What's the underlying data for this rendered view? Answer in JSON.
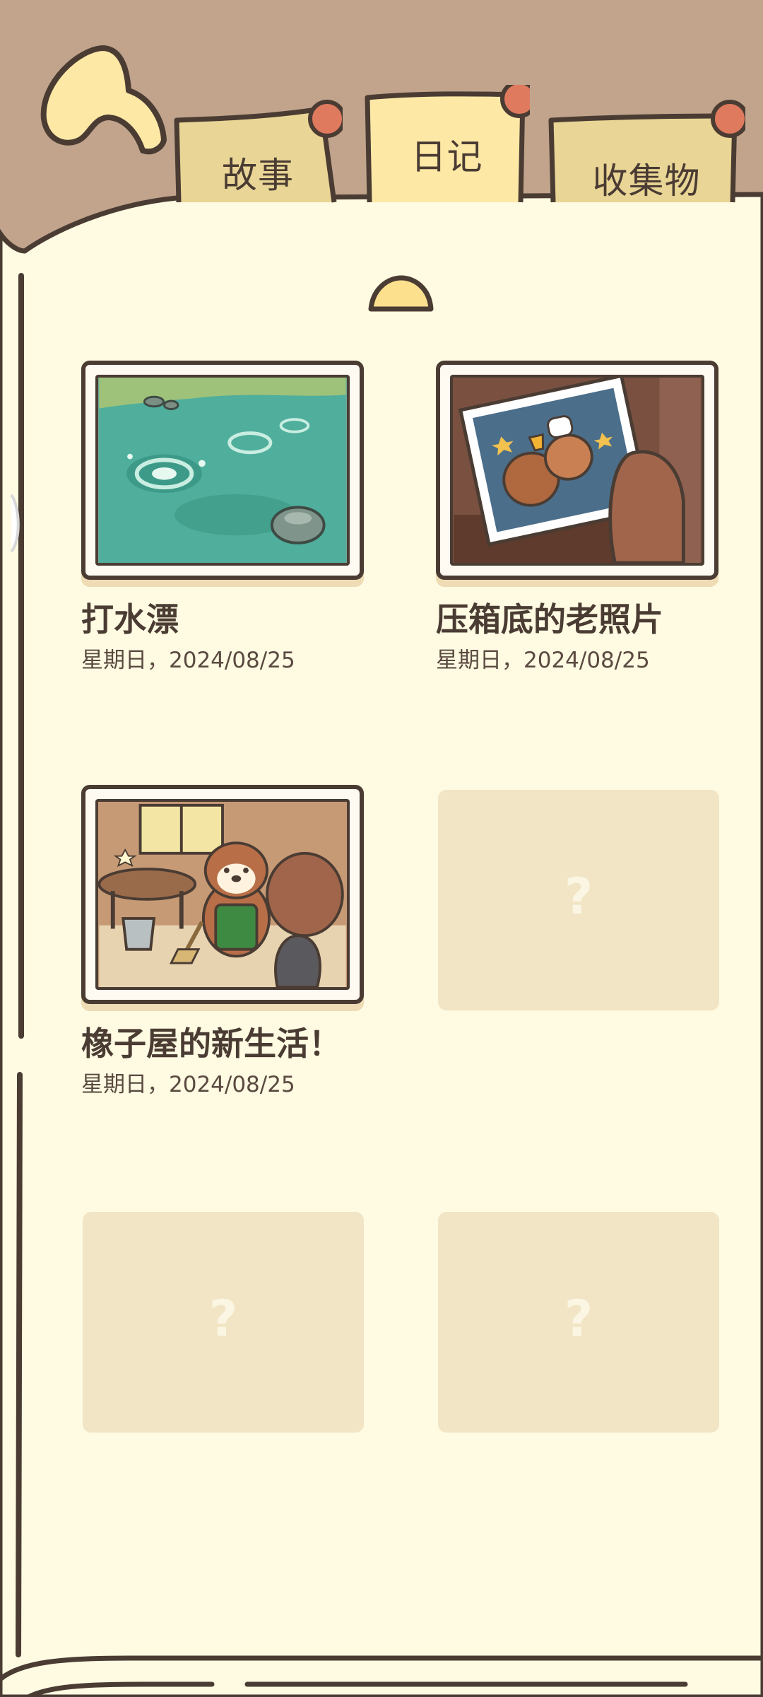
{
  "tabs": [
    {
      "label": "故事"
    },
    {
      "label": "日记"
    },
    {
      "label": "收集物"
    }
  ],
  "active_tab": "日记",
  "diary": {
    "entries": [
      {
        "title": "打水漂",
        "date": "星期日，2024/08/25",
        "scene": "pond-skipping-stones"
      },
      {
        "title": "压箱底的老照片",
        "date": "星期日，2024/08/25",
        "scene": "old-photo-trophy"
      },
      {
        "title": "橡子屋的新生活！",
        "date": "星期日，2024/08/25",
        "scene": "squirrel-cleaning-house"
      }
    ],
    "locked": [
      {
        "symbol": "?"
      },
      {
        "symbol": "?"
      },
      {
        "symbol": "?"
      }
    ]
  },
  "colors": {
    "background": "#c2a48c",
    "page": "#fffae2",
    "outline": "#4a3c33",
    "tab_fill": "#e9d595",
    "tab_active": "#fde8a6",
    "tab_pin": "#e07a5f",
    "locked_card": "#f1e5c5"
  }
}
